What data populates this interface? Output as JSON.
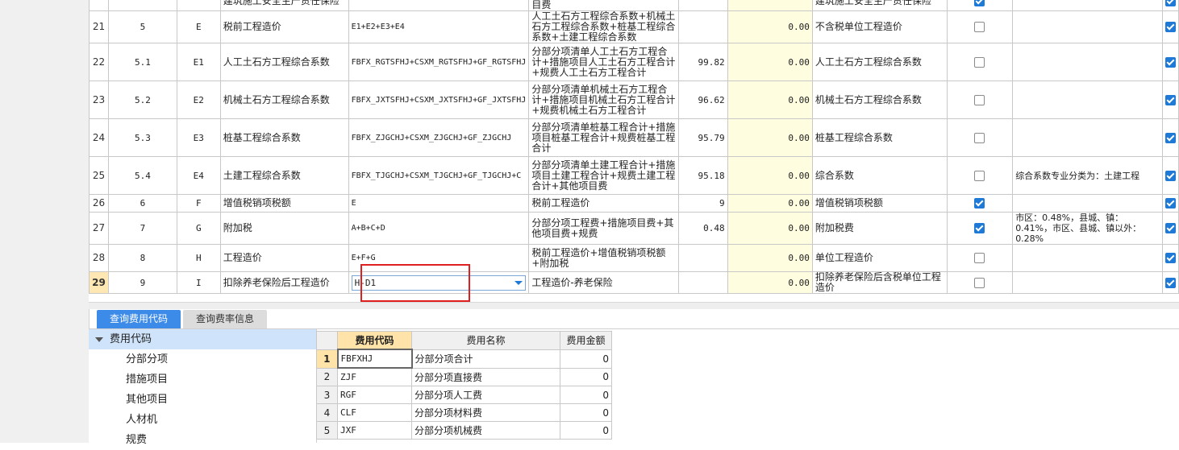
{
  "grid": {
    "rows": [
      {
        "rn": "21",
        "no": "5",
        "code": "E",
        "name": "税前工程造价",
        "base": "E1+E2+E3+E4",
        "desc": "人工土石方工程综合系数+机械土石方工程综合系数+桩基工程综合系数+土建工程综合系数",
        "rate": "",
        "amount": "0.00",
        "category": "不含税单位工程造价",
        "checked": false,
        "note": "",
        "output": true
      },
      {
        "rn": "22",
        "no": "5.1",
        "code": "E1",
        "name": "人工土石方工程综合系数",
        "base": "FBFX_RGTSFHJ+CSXM_RGTSFHJ+GF_RGTSFHJ",
        "desc": "分部分项清单人工土石方工程合计+措施项目人工土石方工程合计+规费人工土石方工程合计",
        "rate": "99.82",
        "amount": "0.00",
        "category": "人工土石方工程综合系数",
        "checked": false,
        "note": "",
        "output": true
      },
      {
        "rn": "23",
        "no": "5.2",
        "code": "E2",
        "name": "机械土石方工程综合系数",
        "base": "FBFX_JXTSFHJ+CSXM_JXTSFHJ+GF_JXTSFHJ",
        "desc": "分部分项清单机械土石方工程合计+措施项目机械土石方工程合计+规费机械土石方工程合计",
        "rate": "96.62",
        "amount": "0.00",
        "category": "机械土石方工程综合系数",
        "checked": false,
        "note": "",
        "output": true
      },
      {
        "rn": "24",
        "no": "5.3",
        "code": "E3",
        "name": "桩基工程综合系数",
        "base": "FBFX_ZJGCHJ+CSXM_ZJGCHJ+GF_ZJGCHJ",
        "desc": "分部分项清单桩基工程合计+措施项目桩基工程合计+规费桩基工程合计",
        "rate": "95.79",
        "amount": "0.00",
        "category": "桩基工程综合系数",
        "checked": false,
        "note": "",
        "output": true
      },
      {
        "rn": "25",
        "no": "5.4",
        "code": "E4",
        "name": "土建工程综合系数",
        "base": "FBFX_TJGCHJ+CSXM_TJGCHJ+GF_TJGCHJ+C",
        "desc": "分部分项清单土建工程合计+措施项目土建工程合计+规费土建工程合计+其他项目费",
        "rate": "95.18",
        "amount": "0.00",
        "category": "综合系数",
        "checked": false,
        "note": "综合系数专业分类为：土建工程",
        "output": true
      },
      {
        "rn": "26",
        "no": "6",
        "code": "F",
        "name": "增值税销项税额",
        "base": "E",
        "desc": "税前工程造价",
        "rate": "9",
        "amount": "0.00",
        "category": "增值税销项税额",
        "checked": true,
        "note": "",
        "output": true
      },
      {
        "rn": "27",
        "no": "7",
        "code": "G",
        "name": "附加税",
        "base": "A+B+C+D",
        "desc": "分部分项工程费+措施项目费+其他项目费+规费",
        "rate": "0.48",
        "amount": "0.00",
        "category": "附加税费",
        "checked": true,
        "note": "市区：0.48%，县城、镇：0.41%，市区、县城、镇以外：0.28%",
        "output": true
      },
      {
        "rn": "28",
        "no": "8",
        "code": "H",
        "name": "工程造价",
        "base": "E+F+G",
        "desc": "税前工程造价+增值税销项税额+附加税",
        "rate": "",
        "amount": "0.00",
        "category": "单位工程造价",
        "checked": false,
        "note": "",
        "output": true
      },
      {
        "rn": "29",
        "no": "9",
        "code": "I",
        "name": "扣除养老保险后工程造价",
        "base": "H-D1",
        "desc": "工程造价-养老保险",
        "rate": "",
        "amount": "0.00",
        "category": "扣除养老保险后含税单位工程造价",
        "checked": false,
        "note": "",
        "output": true
      }
    ],
    "partial_top_row": {
      "name": "建筑施工安全生产责任保险",
      "desc": "目费",
      "category": "建筑施工安全生产责任保险",
      "output": true
    }
  },
  "tabs": [
    {
      "label": "查询费用代码",
      "active": true
    },
    {
      "label": "查询费率信息",
      "active": false
    }
  ],
  "tree": {
    "root": "费用代码",
    "items": [
      "分部分项",
      "措施项目",
      "其他项目",
      "人材机",
      "规费"
    ]
  },
  "code_table": {
    "headers": {
      "code": "费用代码",
      "name": "费用名称",
      "amount": "费用金额"
    },
    "rows": [
      {
        "rn": "1",
        "code": "FBFXHJ",
        "name": "分部分项合计",
        "amount": "0"
      },
      {
        "rn": "2",
        "code": "ZJF",
        "name": "分部分项直接费",
        "amount": "0"
      },
      {
        "rn": "3",
        "code": "RGF",
        "name": "分部分项人工费",
        "amount": "0"
      },
      {
        "rn": "4",
        "code": "CLF",
        "name": "分部分项材料费",
        "amount": "0"
      },
      {
        "rn": "5",
        "code": "JXF",
        "name": "分部分项机械费",
        "amount": "0"
      }
    ]
  }
}
